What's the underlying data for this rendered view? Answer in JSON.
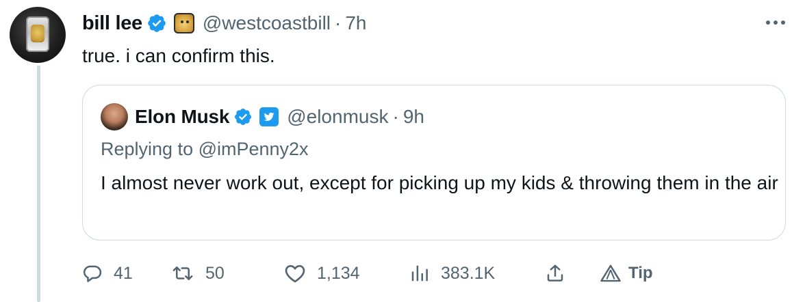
{
  "author": {
    "name": "bill lee",
    "handle": "@westcoastbill",
    "time": "7h"
  },
  "tweet": {
    "text": "true.  i can confirm this."
  },
  "quoted": {
    "name": "Elon Musk",
    "handle": "@elonmusk",
    "time": "9h",
    "replying_to": "Replying to @imPenny2x",
    "text": "I almost never work out, except for picking up my kids & throwing them in the air"
  },
  "actions": {
    "replies": "41",
    "retweets": "50",
    "likes": "1,134",
    "views": "383.1K",
    "tip_label": "Tip"
  },
  "separator": "·",
  "colors": {
    "text": "#0f1419",
    "secondary": "#536471",
    "verified_blue": "#1d9bf0",
    "border": "#cfd9de"
  },
  "icons": {
    "verified": "verified-badge-icon",
    "reply": "speech-bubble-icon",
    "retweet": "retweet-arrows-icon",
    "like": "heart-icon",
    "views": "bar-chart-icon",
    "share": "upload-arrow-icon",
    "tip": "triangle-tip-icon",
    "more": "ellipsis-icon"
  }
}
